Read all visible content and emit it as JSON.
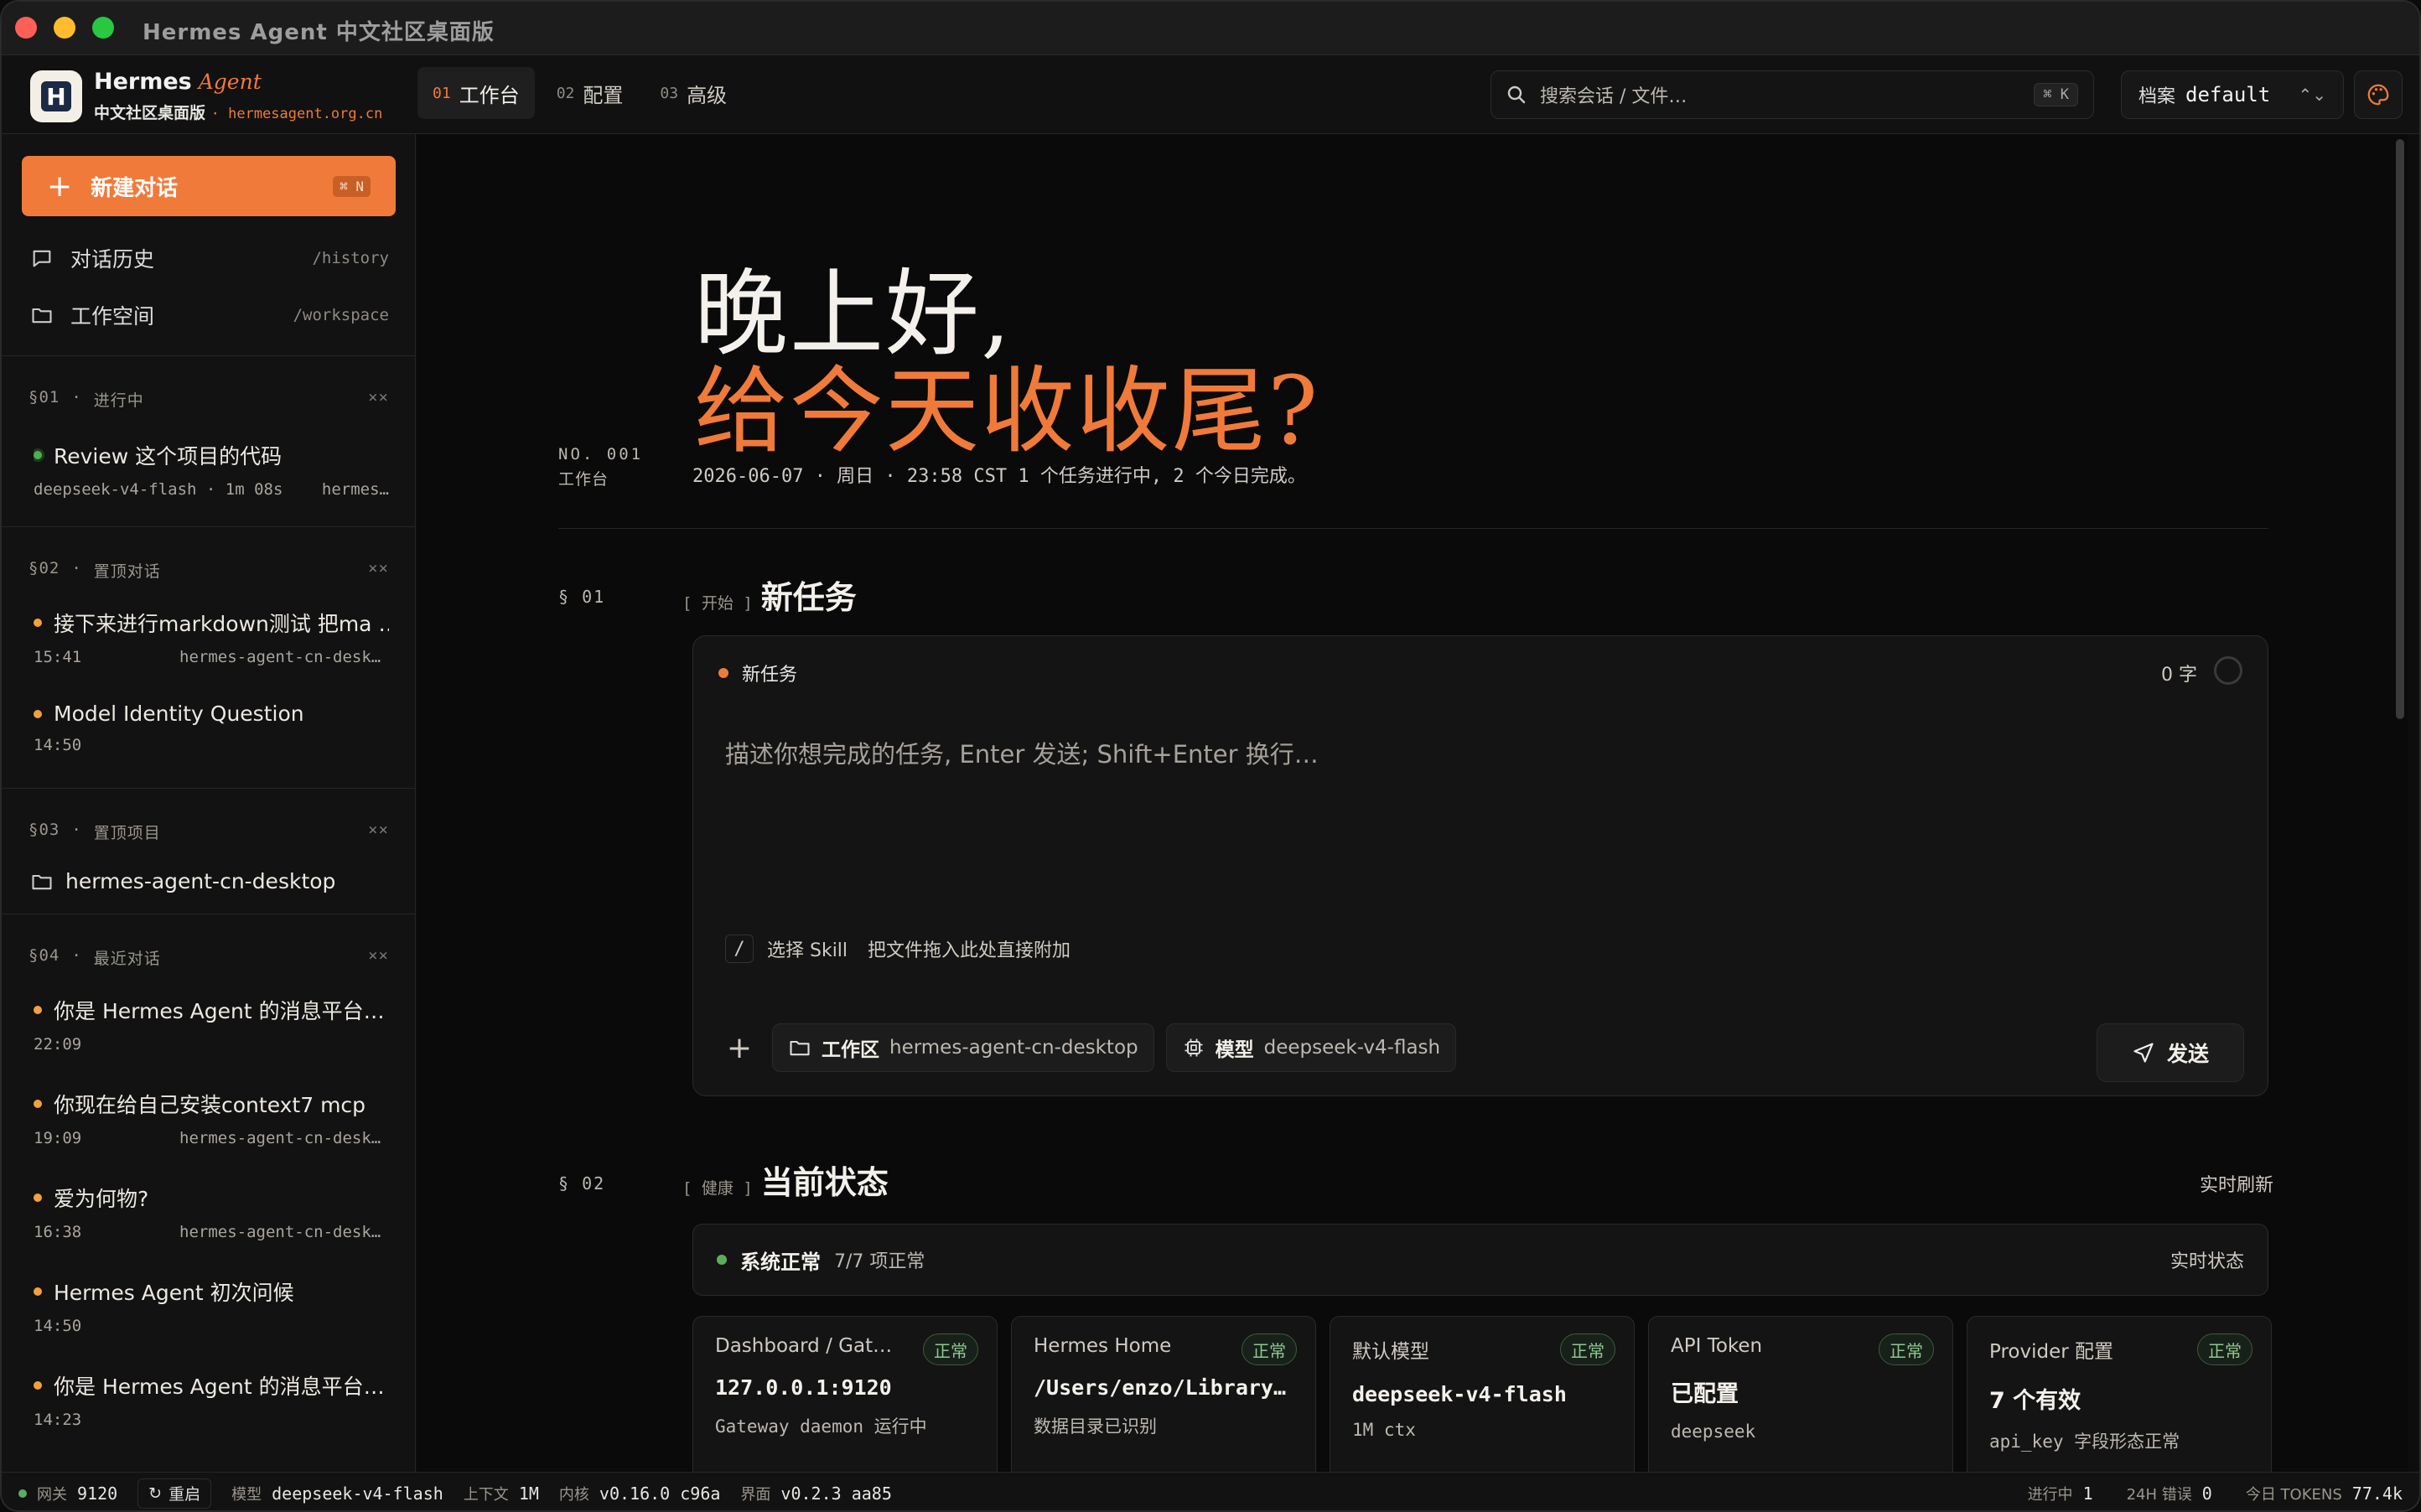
{
  "window": {
    "title": "Hermes Agent 中文社区桌面版"
  },
  "brand": {
    "name": "Hermes",
    "agent": "Agent",
    "subtitle": "中文社区桌面版",
    "domain": "· hermesagent.org.cn"
  },
  "nav": {
    "tabs": [
      {
        "num": "01",
        "label": "工作台"
      },
      {
        "num": "02",
        "label": "配置"
      },
      {
        "num": "03",
        "label": "高级"
      }
    ]
  },
  "search": {
    "placeholder": "搜索会话 / 文件…",
    "shortcut": "⌘ K"
  },
  "profile": {
    "label": "档案",
    "value": "default"
  },
  "sidebar": {
    "new_chat": {
      "label": "新建对话",
      "shortcut": "⌘ N"
    },
    "links": [
      {
        "label": "对话历史",
        "path": "/history"
      },
      {
        "label": "工作空间",
        "path": "/workspace"
      }
    ],
    "sections": [
      {
        "id": "§01",
        "name": "进行中",
        "items": [
          {
            "title": "Review 这个项目的代码",
            "meta1": "deepseek-v4-flash · 1m 08s",
            "meta2": "hermes…"
          }
        ]
      },
      {
        "id": "§02",
        "name": "置顶对话",
        "items": [
          {
            "title": "接下来进行markdown测试 把ma …",
            "time": "15:41",
            "project": "hermes-agent-cn-desktop"
          },
          {
            "title": "Model Identity Question",
            "time": "14:50",
            "project": ""
          }
        ]
      },
      {
        "id": "§03",
        "name": "置顶项目",
        "items": [
          {
            "title": "hermes-agent-cn-desktop"
          }
        ]
      },
      {
        "id": "§04",
        "name": "最近对话",
        "items": [
          {
            "title": "你是 Hermes Agent 的消息平台…",
            "time": "22:09",
            "project": ""
          },
          {
            "title": "你现在给自己安装context7 mcp",
            "time": "19:09",
            "project": "hermes-agent-cn-desktop"
          },
          {
            "title": "爱为何物?",
            "time": "16:38",
            "project": "hermes-agent-cn-desktop"
          },
          {
            "title": "Hermes Agent 初次问候",
            "time": "14:50",
            "project": ""
          },
          {
            "title": "你是 Hermes Agent 的消息平台…",
            "time": "14:23",
            "project": ""
          }
        ]
      }
    ],
    "close_label": "××"
  },
  "hero": {
    "line1": "晚上好,",
    "line2": "给今天收收尾?",
    "no": "NO. 001",
    "no_sub": "工作台",
    "dateline": "2026-06-07 · 周日 · 23:58 CST  1 个任务进行中, 2 个今日完成。"
  },
  "new_task": {
    "sec_num": "§ 01",
    "tag": "[ 开始 ]",
    "title": "新任务",
    "header": "新任务",
    "word_count": "0 字",
    "placeholder": "描述你想完成的任务, Enter 发送; Shift+Enter 换行…",
    "skill_slash": "/",
    "skill_label": "选择 Skill",
    "skill_hint": "把文件拖入此处直接附加",
    "workspace_label": "工作区",
    "workspace_value": "hermes-agent-cn-desktop",
    "model_label": "模型",
    "model_value": "deepseek-v4-flash",
    "send_label": "发送"
  },
  "status": {
    "sec_num": "§ 02",
    "tag": "[ 健康 ]",
    "title": "当前状态",
    "refresh": "实时刷新",
    "summary": "系统正常",
    "summary_detail": "7/7 项正常",
    "summary_right": "实时状态",
    "cards": [
      {
        "label": "Dashboard / Gate…",
        "badge": "正常",
        "value": "127.0.0.1:9120",
        "sub": "Gateway daemon 运行中"
      },
      {
        "label": "Hermes Home",
        "badge": "正常",
        "value": "/Users/enzo/Library/…",
        "sub": "数据目录已识别"
      },
      {
        "label": "默认模型",
        "badge": "正常",
        "value": "deepseek-v4-flash",
        "sub": "1M ctx"
      },
      {
        "label": "API Token",
        "badge": "正常",
        "value": "已配置",
        "sub": "deepseek"
      },
      {
        "label": "Provider 配置",
        "badge": "正常",
        "value": "7 个有效",
        "sub": "api_key 字段形态正常"
      }
    ]
  },
  "bottombar": {
    "gateway_label": "网关",
    "gateway_value": "9120",
    "restart": "重启",
    "model_label": "模型",
    "model_value": "deepseek-v4-flash",
    "ctx_label": "上下文",
    "ctx_value": "1M",
    "core_label": "内核",
    "core_value": "v0.16.0 c96a",
    "ui_label": "界面",
    "ui_value": "v0.2.3 aa85",
    "running_label": "进行中",
    "running_value": "1",
    "errors_label": "24H 错误",
    "errors_value": "0",
    "tokens_label": "今日 TOKENS",
    "tokens_value": "77.4k"
  },
  "colors": {
    "accent": "#f07a3a",
    "ok": "#5cae5f"
  }
}
